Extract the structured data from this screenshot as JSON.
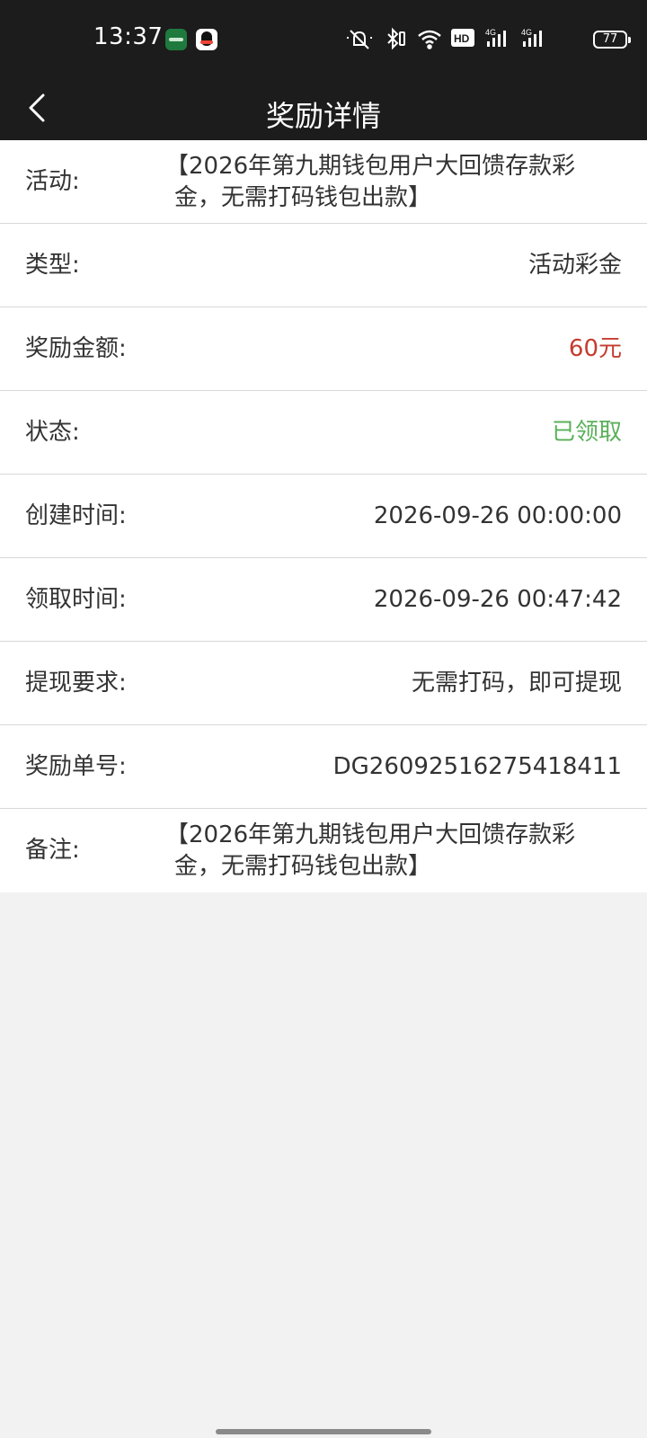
{
  "status_bar": {
    "time": "13:37",
    "battery": "77",
    "icons": [
      "green-app-icon",
      "qq-icon",
      "mute-icon",
      "bluetooth-icon",
      "wifi-icon",
      "hd-icon",
      "signal-4g-icon",
      "signal-4g-icon"
    ]
  },
  "header": {
    "back_icon": "back-arrow-icon",
    "title": "奖励详情"
  },
  "details": [
    {
      "label": "活动:",
      "value": "【2026年第九期钱包用户大回馈存款彩金，无需打码钱包出款】",
      "style": "multi"
    },
    {
      "label": "类型:",
      "value": "活动彩金",
      "style": "normal"
    },
    {
      "label": "奖励金额:",
      "value": "60元",
      "style": "red"
    },
    {
      "label": "状态:",
      "value": "已领取",
      "style": "green"
    },
    {
      "label": "创建时间:",
      "value": "2026-09-26 00:00:00",
      "style": "normal"
    },
    {
      "label": "领取时间:",
      "value": "2026-09-26 00:47:42",
      "style": "normal"
    },
    {
      "label": "提现要求:",
      "value": "无需打码，即可提现",
      "style": "normal"
    },
    {
      "label": "奖励单号:",
      "value": "DG26092516275418411",
      "style": "normal"
    },
    {
      "label": "备注:",
      "value": "【2026年第九期钱包用户大回馈存款彩金，无需打码钱包出款】",
      "style": "multi"
    }
  ],
  "colors": {
    "header_bg": "#1c1c1c",
    "amount_red": "#c53b2f",
    "status_green": "#5ab05a",
    "page_bg": "#f2f2f2"
  }
}
